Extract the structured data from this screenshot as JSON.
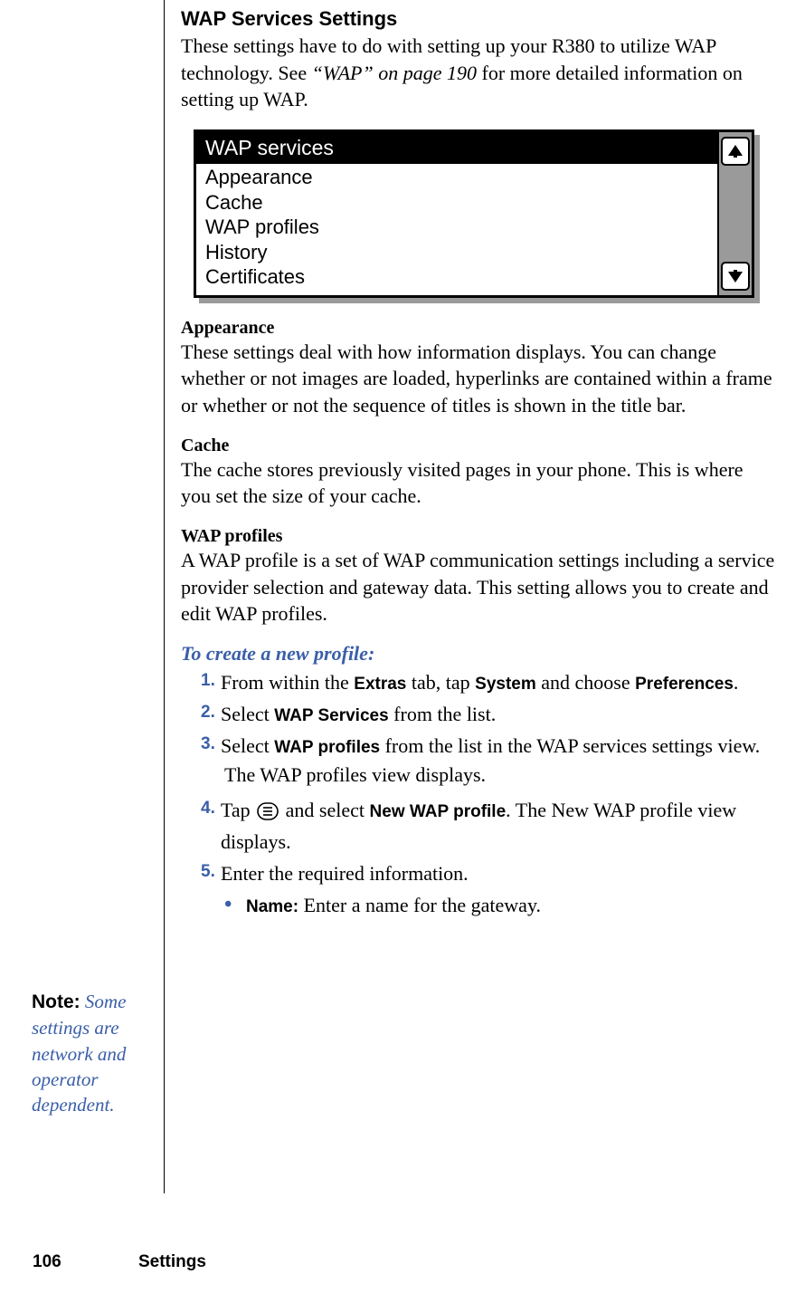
{
  "header": {
    "title": "WAP Services Settings",
    "intro_pre": "These settings have to do with setting up your R380 to utilize WAP technology. See ",
    "intro_ref": "“WAP” on page 190",
    "intro_post": " for more detailed information on setting up WAP."
  },
  "device": {
    "title": "WAP services",
    "items": [
      "Appearance",
      "Cache",
      "WAP profiles",
      "History",
      "Certificates"
    ]
  },
  "sections": {
    "appearance": {
      "title": "Appearance",
      "body": "These settings deal with how information displays. You can change whether or not images are loaded, hyperlinks are contained within a frame or whether or not the sequence of titles is shown in the title bar."
    },
    "cache": {
      "title": "Cache",
      "body": "The cache stores previously visited pages in your phone. This is where you set the size of your cache."
    },
    "wap_profiles": {
      "title": "WAP profiles",
      "body": "A WAP profile is a set of WAP communication settings including a service provider selection and gateway data. This setting allows you to create and edit WAP profiles."
    }
  },
  "instructions": {
    "title": "To create a new profile:",
    "steps": {
      "s1": {
        "num": "1.",
        "pre": " From within the ",
        "b1": "Extras",
        "mid1": " tab, tap ",
        "b2": "System",
        "mid2": " and choose ",
        "b3": "Preferences",
        "post": "."
      },
      "s2": {
        "num": "2.",
        "pre": " Select ",
        "b1": "WAP Services",
        "post": " from the list."
      },
      "s3": {
        "num": "3.",
        "pre": " Select ",
        "b1": "WAP profiles",
        "post": " from the list in the WAP services settings view.",
        "extra": "The WAP profiles view displays."
      },
      "s4": {
        "num": "4.",
        "pre": " Tap ",
        "mid": " and select ",
        "b1": "New WAP profile",
        "post": ". The New WAP profile view displays."
      },
      "s5": {
        "num": "5.",
        "text": " Enter the required information."
      }
    },
    "bullet": {
      "label": "Name:",
      "text": " Enter a name for the gateway."
    }
  },
  "note": {
    "label": "Note:",
    "text": "Some settings are network and operator dependent."
  },
  "footer": {
    "page": "106",
    "title": "Settings"
  }
}
